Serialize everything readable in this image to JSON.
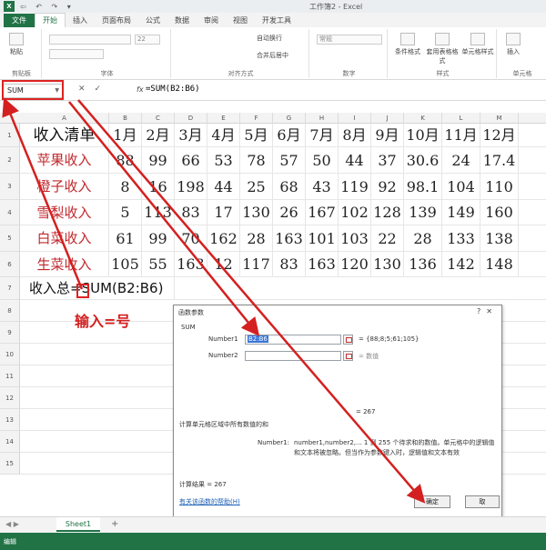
{
  "app": {
    "window_title": "工作簿2 - Excel",
    "logo": "X"
  },
  "quick_access": "⇦ ↶ ↷ ▾",
  "tabs": [
    {
      "label": "文件",
      "type": "file"
    },
    {
      "label": "开始",
      "type": "active"
    },
    {
      "label": "插入"
    },
    {
      "label": "页面布局"
    },
    {
      "label": "公式"
    },
    {
      "label": "数据"
    },
    {
      "label": "审阅"
    },
    {
      "label": "视图"
    },
    {
      "label": "开发工具"
    }
  ],
  "ribbon": {
    "paste": "粘贴",
    "clipboard_label": "剪贴板",
    "font_label": "字体",
    "font_size": "22",
    "align_label": "对齐方式",
    "wrap_text": "自动换行",
    "merge_center": "合并后居中",
    "number_label": "数字",
    "number_format": "常规",
    "styles_label": "样式",
    "cond_format": "条件格式",
    "table_format": "套用表格格式",
    "cell_styles": "单元格样式",
    "insert": "插入",
    "cells_label": "单元格"
  },
  "formula_bar": {
    "name_box": "SUM",
    "cancel": "✕",
    "enter": "✓",
    "fx": "fx",
    "formula": "=SUM(B2:B6)"
  },
  "sheet": {
    "columns": [
      "A",
      "B",
      "C",
      "D",
      "E",
      "F",
      "G",
      "H",
      "I",
      "J",
      "K",
      "L",
      "M"
    ],
    "rows": [
      "1",
      "2",
      "3",
      "4",
      "5",
      "6",
      "7",
      "8",
      "9",
      "10",
      "11",
      "12",
      "13",
      "14",
      "15"
    ],
    "row1": [
      "收入清单",
      "1月",
      "2月",
      "3月",
      "4月",
      "5月",
      "6月",
      "7月",
      "8月",
      "9月",
      "10月",
      "11月",
      "12月"
    ],
    "data": [
      {
        "label": "苹果收入",
        "values": [
          "88",
          "99",
          "66",
          "53",
          "78",
          "57",
          "50",
          "44",
          "37",
          "30.6",
          "24",
          "17.4"
        ]
      },
      {
        "label": "橙子收入",
        "values": [
          "8",
          "16",
          "198",
          "44",
          "25",
          "68",
          "43",
          "119",
          "92",
          "98.1",
          "104",
          "110"
        ]
      },
      {
        "label": "雪梨收入",
        "values": [
          "5",
          "113",
          "83",
          "17",
          "130",
          "26",
          "167",
          "102",
          "128",
          "139",
          "149",
          "160"
        ]
      },
      {
        "label": "白菜收入",
        "values": [
          "61",
          "99",
          "70",
          "162",
          "28",
          "163",
          "101",
          "103",
          "22",
          "28",
          "133",
          "138"
        ]
      },
      {
        "label": "生菜收入",
        "values": [
          "105",
          "55",
          "163",
          "12",
          "117",
          "83",
          "163",
          "120",
          "130",
          "136",
          "142",
          "148"
        ]
      }
    ],
    "row7_label": "收入总=SUM(B2:B6)"
  },
  "annotation": "输入=号",
  "dialog": {
    "title": "函数参数",
    "function_name": "SUM",
    "number1_label": "Number1",
    "number1_value": "B2:B6",
    "number1_result": "= {88;8;5;61;105}",
    "number2_label": "Number2",
    "number2_result": "= 数值",
    "total_result": "= 267",
    "description": "计算单元格区域中所有数值的和",
    "arg_name": "Number1:",
    "arg_desc_line1": "number1,number2,... 1 到 255 个待求和的数值。单元格中的逻辑值",
    "arg_desc_line2": "和文本将被忽略。但当作为参数键入时，逻辑值和文本有效",
    "calc_result": "计算结果 =  267",
    "help_link": "有关该函数的帮助(H)",
    "ok": "确定",
    "cancel": "取"
  },
  "sheet_tabs": {
    "name": "Sheet1",
    "add": "+"
  },
  "status": "编辑",
  "colors": {
    "excel_green": "#217346",
    "annotation_red": "#d42020",
    "label_red": "#c0282d"
  }
}
